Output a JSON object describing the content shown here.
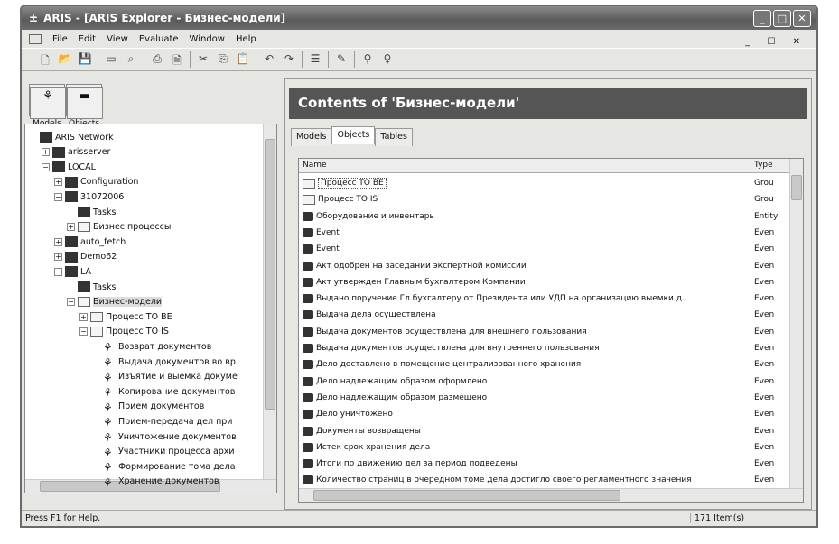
{
  "window": {
    "title": "ARIS - [ARIS Explorer - Бизнес-модели]",
    "controls": [
      "_",
      "□",
      "✕"
    ]
  },
  "menu": [
    "File",
    "Edit",
    "View",
    "Evaluate",
    "Window",
    "Help"
  ],
  "mdi_controls": "_ ☐ ✕",
  "toolbar": [
    "new-icon",
    "open-icon",
    "save-icon",
    "sep",
    "open-db-icon",
    "find-icon",
    "sep",
    "print-icon",
    "print-preview-icon",
    "sep",
    "cut-icon",
    "copy-icon",
    "paste-icon",
    "sep",
    "undo-icon",
    "redo-icon",
    "sep",
    "properties-icon",
    "sep",
    "edit-icon",
    "sep",
    "search-icon",
    "help-icon"
  ],
  "left": {
    "buttons": [
      "Models",
      "Objects"
    ],
    "tree": [
      {
        "label": "ARIS Network",
        "level": 0,
        "pm": ""
      },
      {
        "label": "arisserver",
        "level": 1,
        "pm": "+"
      },
      {
        "label": "LOCAL",
        "level": 1,
        "pm": "−"
      },
      {
        "label": "Configuration",
        "level": 2,
        "pm": "+"
      },
      {
        "label": "31072006",
        "level": 2,
        "pm": "−"
      },
      {
        "label": "Tasks",
        "level": 3,
        "pm": ""
      },
      {
        "label": "Бизнес процессы",
        "level": 3,
        "pm": "+"
      },
      {
        "label": "auto_fetch",
        "level": 2,
        "pm": "+"
      },
      {
        "label": "Demo62",
        "level": 2,
        "pm": "+"
      },
      {
        "label": "LA",
        "level": 2,
        "pm": "−"
      },
      {
        "label": "Tasks",
        "level": 3,
        "pm": ""
      },
      {
        "label": "Бизнес-модели",
        "level": 3,
        "pm": "−"
      },
      {
        "label": "Процесс TO BE",
        "level": 4,
        "pm": "+"
      },
      {
        "label": "Процесс TO IS",
        "level": 4,
        "pm": "−"
      },
      {
        "label": "Возврат документов",
        "level": 5,
        "pm": ""
      },
      {
        "label": "Выдача документов во вр",
        "level": 5,
        "pm": ""
      },
      {
        "label": "Изъятие и выемка докуме",
        "level": 5,
        "pm": ""
      },
      {
        "label": "Копирование документов",
        "level": 5,
        "pm": ""
      },
      {
        "label": "Прием документов",
        "level": 5,
        "pm": ""
      },
      {
        "label": "Прием-передача дел при",
        "level": 5,
        "pm": ""
      },
      {
        "label": "Уничтожение документов",
        "level": 5,
        "pm": ""
      },
      {
        "label": "Участники процесса архи",
        "level": 5,
        "pm": ""
      },
      {
        "label": "Формирование тома дела",
        "level": 5,
        "pm": ""
      },
      {
        "label": "Хранение документов",
        "level": 5,
        "pm": ""
      }
    ]
  },
  "right": {
    "header": "Contents of 'Бизнес-модели'",
    "tabs": [
      "Models",
      "Objects",
      "Tables"
    ],
    "active_tab": 1,
    "columns": [
      "Name",
      "Type"
    ],
    "rows": [
      {
        "name": "Процесс TO BE",
        "type": "Grou",
        "kind": "folder"
      },
      {
        "name": "Процесс TO IS",
        "type": "Grou",
        "kind": "folder"
      },
      {
        "name": "Оборудование и инвентарь",
        "type": "Entity",
        "kind": "obj"
      },
      {
        "name": "Event",
        "type": "Even",
        "kind": "obj"
      },
      {
        "name": "Event",
        "type": "Even",
        "kind": "obj"
      },
      {
        "name": "Акт одобрен на заседании экспертной комиссии",
        "type": "Even",
        "kind": "obj"
      },
      {
        "name": "Акт утвержден Главным бухгалтером Компании",
        "type": "Even",
        "kind": "obj"
      },
      {
        "name": "Выдано поручение Гл.бухгалтеру от Президента или УДП на организацию выемки д...",
        "type": "Even",
        "kind": "obj"
      },
      {
        "name": "Выдача дела осуществлена",
        "type": "Even",
        "kind": "obj"
      },
      {
        "name": "Выдача документов  осуществлена для внешнего пользования",
        "type": "Even",
        "kind": "obj"
      },
      {
        "name": "Выдача документов осуществлена для внутреннего пользования",
        "type": "Even",
        "kind": "obj"
      },
      {
        "name": "Дело доставлено в помещение централизованного хранения",
        "type": "Even",
        "kind": "obj"
      },
      {
        "name": "Дело надлежащим образом оформлено",
        "type": "Even",
        "kind": "obj"
      },
      {
        "name": "Дело надлежащим образом размещено",
        "type": "Even",
        "kind": "obj"
      },
      {
        "name": "Дело уничтожено",
        "type": "Even",
        "kind": "obj"
      },
      {
        "name": "Документы возвращены",
        "type": "Even",
        "kind": "obj"
      },
      {
        "name": "Истек срок хранения дела",
        "type": "Even",
        "kind": "obj"
      },
      {
        "name": "Итоги по движению дел за период подведены",
        "type": "Even",
        "kind": "obj"
      },
      {
        "name": "Количество страниц в очередном томе дела достигло своего регламентного значения",
        "type": "Even",
        "kind": "obj"
      }
    ]
  },
  "status": {
    "help": "Press F1 for Help.",
    "count": "171 Item(s)"
  }
}
